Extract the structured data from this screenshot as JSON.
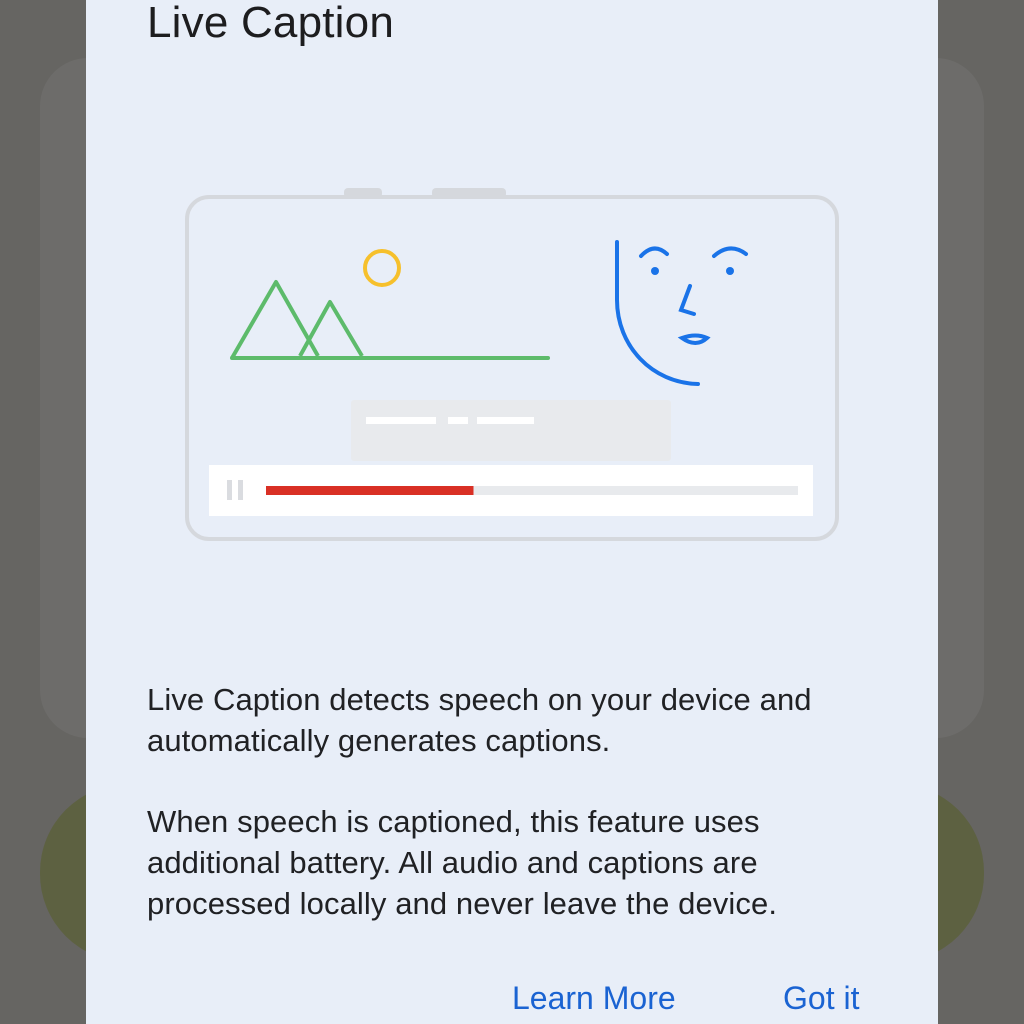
{
  "dialog": {
    "title": "Live Caption",
    "body_paragraphs": [
      "Live Caption detects speech on your device and automatically generates captions.",
      "When speech is captioned, this feature uses additional battery. All audio and captions are processed locally and never leave the device."
    ],
    "buttons": {
      "learn_more": "Learn More",
      "got_it": "Got it"
    }
  },
  "illustration": {
    "caption_progress": 0.39,
    "colors": {
      "mountains": "#5dbb6b",
      "sun": "#f6c02c",
      "face": "#1a73e8",
      "progress": "#d93025",
      "frame": "#d5d8dd"
    }
  },
  "colors": {
    "accent": "#1a63d2",
    "dialog_background": "#e8eef8",
    "scrim": "#666562"
  }
}
